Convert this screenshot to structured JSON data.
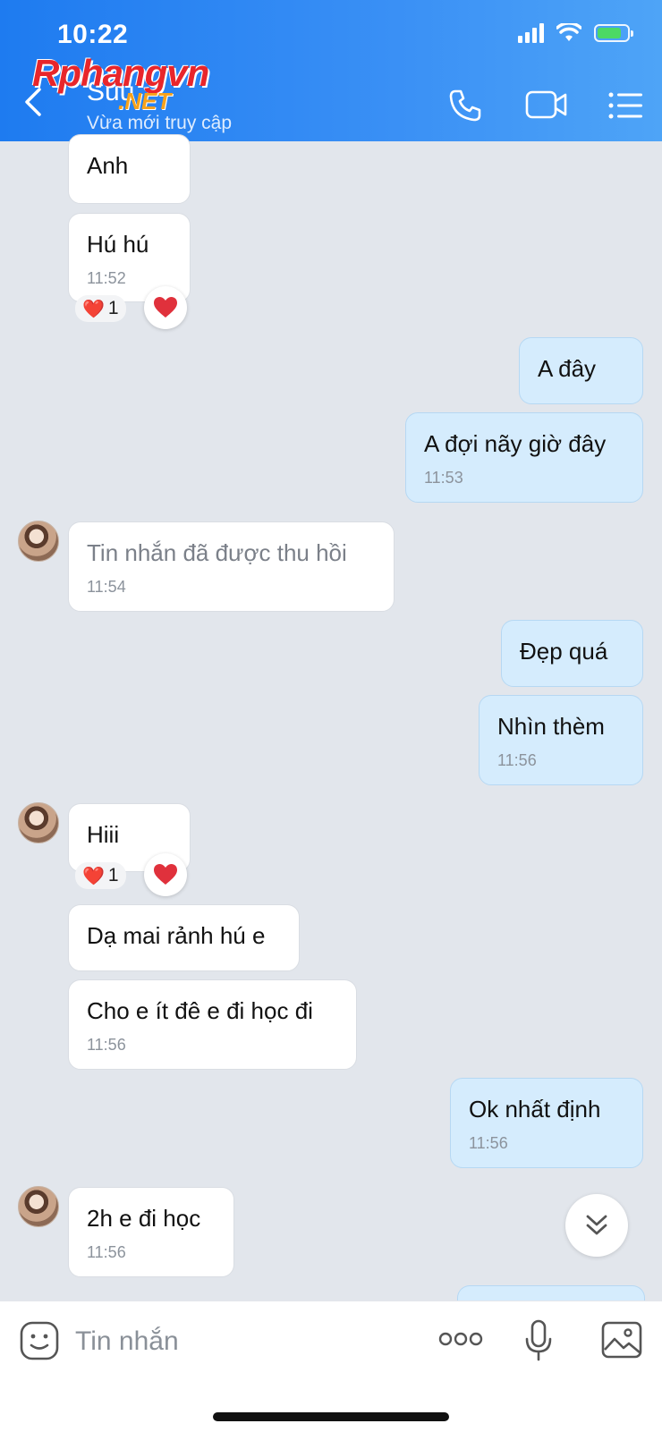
{
  "status_bar": {
    "time": "10:22"
  },
  "header": {
    "contact_name": "Suu",
    "contact_status": "Vừa mới truy cập",
    "watermark_main": "Rphangvn",
    "watermark_sub": ".NET"
  },
  "messages": [
    {
      "side": "in",
      "text": "Anh"
    },
    {
      "side": "in",
      "text": "Hú hú",
      "time": "11:52",
      "reaction": {
        "emoji": "❤️",
        "count": "1"
      }
    },
    {
      "side": "out",
      "text": "A đây"
    },
    {
      "side": "out",
      "text": "A đợi nãy giờ đây",
      "time": "11:53"
    },
    {
      "side": "in",
      "text": "Tin nhắn đã được thu hồi",
      "time": "11:54",
      "recalled": true
    },
    {
      "side": "out",
      "text": "Đẹp quá"
    },
    {
      "side": "out",
      "text": "Nhìn thèm",
      "time": "11:56"
    },
    {
      "side": "in",
      "text": "Hiii",
      "reaction": {
        "emoji": "❤️",
        "count": "1"
      }
    },
    {
      "side": "in",
      "text": "Dạ mai rảnh hú e"
    },
    {
      "side": "in",
      "text": "Cho e ít đê e đi học đi",
      "time": "11:56"
    },
    {
      "side": "out",
      "text": "Ok nhất định",
      "time": "11:56"
    },
    {
      "side": "in",
      "text": "2h e đi học",
      "time": "11:56"
    }
  ],
  "input": {
    "placeholder": "Tin nhắn"
  },
  "colors": {
    "header": "#1e7bf0",
    "outgoing_bubble": "#d5ecfd",
    "incoming_bubble": "#ffffff",
    "background": "#e2e6ec"
  },
  "icons": [
    "chevron-left-icon",
    "phone-icon",
    "video-camera-icon",
    "menu-list-icon",
    "heart-icon",
    "scroll-down-icon",
    "emoji-icon",
    "more-icon",
    "microphone-icon",
    "image-icon"
  ]
}
